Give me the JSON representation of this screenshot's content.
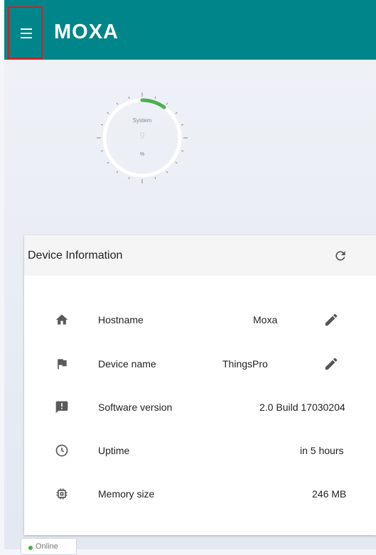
{
  "header": {
    "brand": "MOXA",
    "menu_icon": "hamburger-menu-icon",
    "accent_color": "#00858a"
  },
  "gauge": {
    "label": "System",
    "value": "9",
    "unit": "%",
    "arc_color": "#4caf50"
  },
  "device_info": {
    "title": "Device Information",
    "refresh_icon": "refresh-icon",
    "rows": [
      {
        "icon": "home-icon",
        "label": "Hostname",
        "value": "Moxa",
        "editable": true
      },
      {
        "icon": "flag-icon",
        "label": "Device name",
        "value": "ThingsPro",
        "editable": true
      },
      {
        "icon": "alert-message-icon",
        "label": "Software version",
        "value": "2.0 Build 17030204",
        "editable": false
      },
      {
        "icon": "clock-icon",
        "label": "Uptime",
        "value": "in 5 hours",
        "editable": false
      },
      {
        "icon": "memory-chip-icon",
        "label": "Memory size",
        "value": "246 MB",
        "editable": false
      }
    ]
  },
  "status": {
    "text": "Online",
    "color": "#4caf50"
  }
}
